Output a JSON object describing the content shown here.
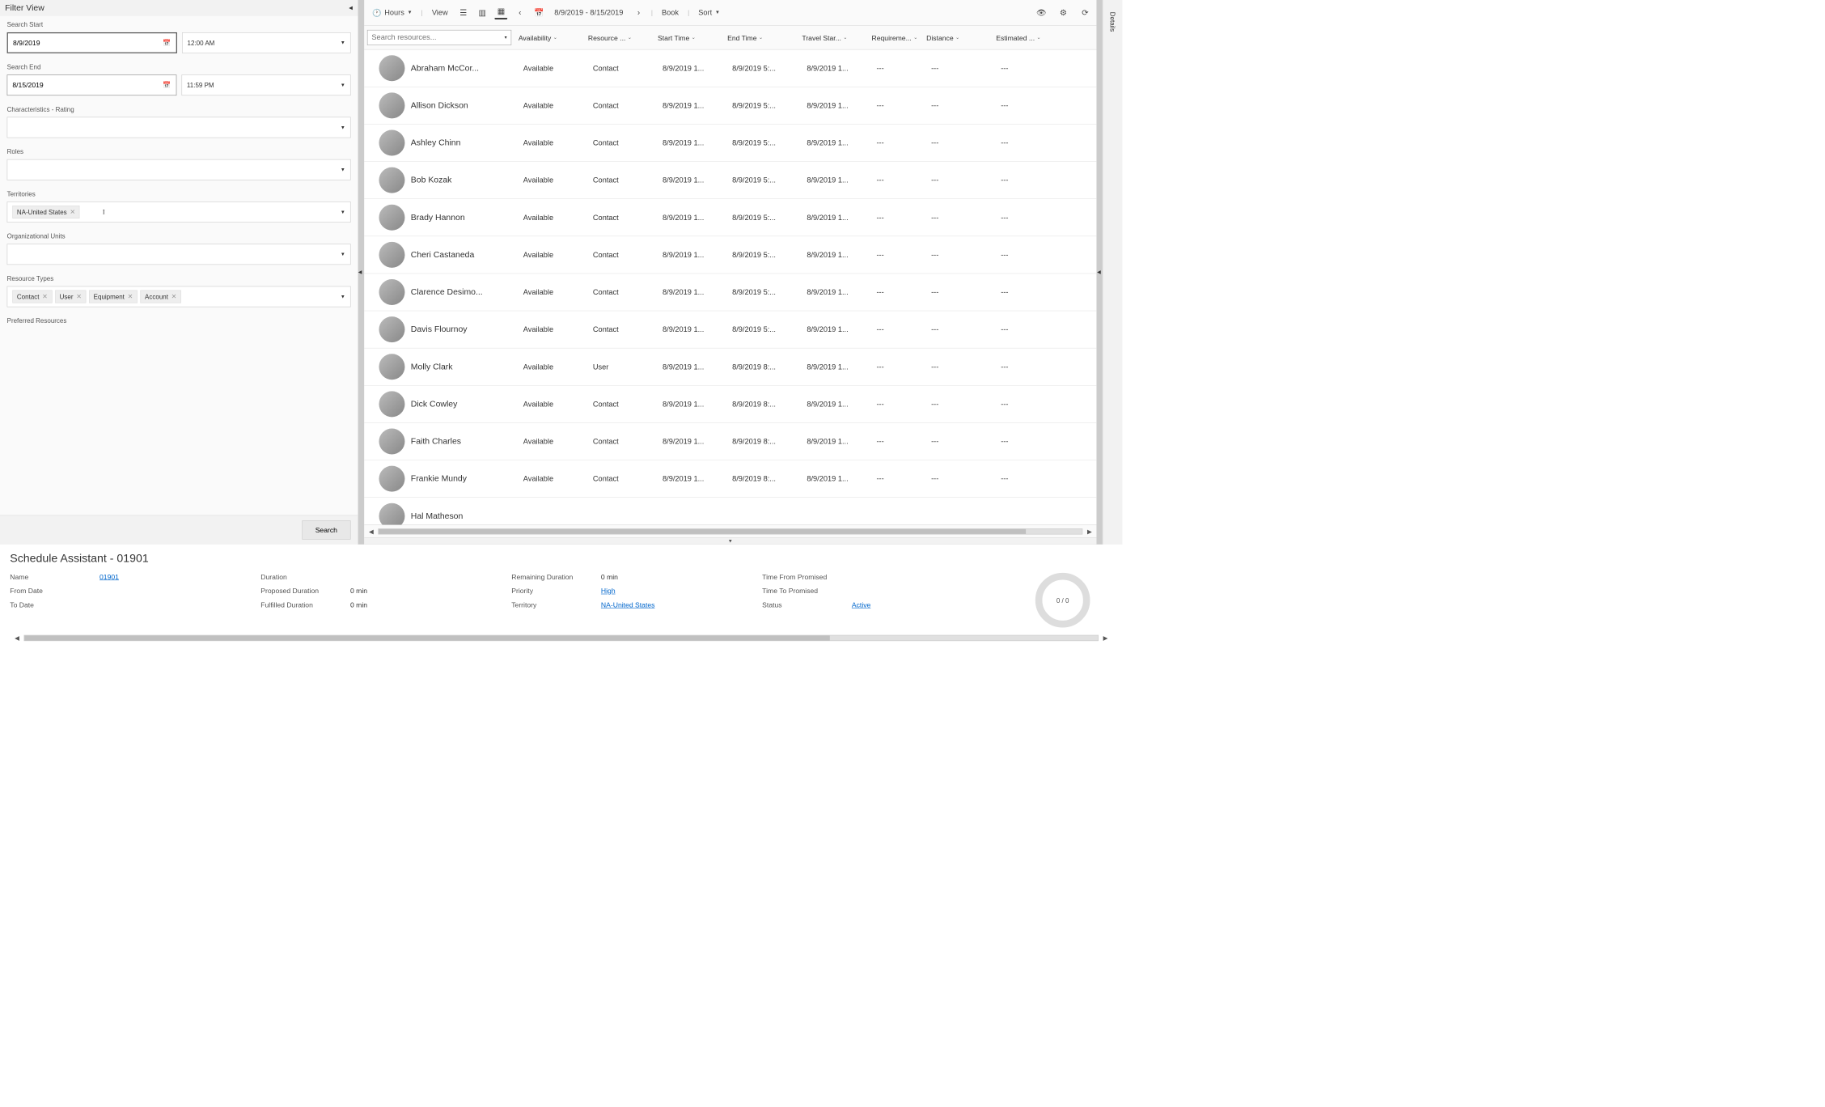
{
  "filter": {
    "title": "Filter View",
    "search_start_label": "Search Start",
    "search_start_date": "8/9/2019",
    "search_start_time": "12:00 AM",
    "search_end_label": "Search End",
    "search_end_date": "8/15/2019",
    "search_end_time": "11:59 PM",
    "characteristics_label": "Characteristics - Rating",
    "roles_label": "Roles",
    "territories_label": "Territories",
    "territories_tags": [
      "NA-United States"
    ],
    "org_units_label": "Organizational Units",
    "resource_types_label": "Resource Types",
    "resource_types_tags": [
      "Contact",
      "User",
      "Equipment",
      "Account"
    ],
    "preferred_label": "Preferred Resources",
    "search_btn": "Search"
  },
  "toolbar": {
    "hours_label": "Hours",
    "view_label": "View",
    "date_range": "8/9/2019 - 8/15/2019",
    "book_label": "Book",
    "sort_label": "Sort"
  },
  "grid": {
    "search_placeholder": "Search resources...",
    "columns": [
      "Availability",
      "Resource ...",
      "Start Time",
      "End Time",
      "Travel Star...",
      "Requireme...",
      "Distance",
      "Estimated ..."
    ],
    "rows": [
      {
        "name": "Abraham McCor...",
        "avail": "Available",
        "type": "Contact",
        "start": "8/9/2019 1...",
        "end": "8/9/2019 5:...",
        "travel": "8/9/2019 1...",
        "req": "---",
        "dist": "---",
        "est": "---"
      },
      {
        "name": "Allison Dickson",
        "avail": "Available",
        "type": "Contact",
        "start": "8/9/2019 1...",
        "end": "8/9/2019 5:...",
        "travel": "8/9/2019 1...",
        "req": "---",
        "dist": "---",
        "est": "---"
      },
      {
        "name": "Ashley Chinn",
        "avail": "Available",
        "type": "Contact",
        "start": "8/9/2019 1...",
        "end": "8/9/2019 5:...",
        "travel": "8/9/2019 1...",
        "req": "---",
        "dist": "---",
        "est": "---"
      },
      {
        "name": "Bob Kozak",
        "avail": "Available",
        "type": "Contact",
        "start": "8/9/2019 1...",
        "end": "8/9/2019 5:...",
        "travel": "8/9/2019 1...",
        "req": "---",
        "dist": "---",
        "est": "---"
      },
      {
        "name": "Brady Hannon",
        "avail": "Available",
        "type": "Contact",
        "start": "8/9/2019 1...",
        "end": "8/9/2019 5:...",
        "travel": "8/9/2019 1...",
        "req": "---",
        "dist": "---",
        "est": "---"
      },
      {
        "name": "Cheri Castaneda",
        "avail": "Available",
        "type": "Contact",
        "start": "8/9/2019 1...",
        "end": "8/9/2019 5:...",
        "travel": "8/9/2019 1...",
        "req": "---",
        "dist": "---",
        "est": "---"
      },
      {
        "name": "Clarence Desimo...",
        "avail": "Available",
        "type": "Contact",
        "start": "8/9/2019 1...",
        "end": "8/9/2019 5:...",
        "travel": "8/9/2019 1...",
        "req": "---",
        "dist": "---",
        "est": "---"
      },
      {
        "name": "Davis Flournoy",
        "avail": "Available",
        "type": "Contact",
        "start": "8/9/2019 1...",
        "end": "8/9/2019 5:...",
        "travel": "8/9/2019 1...",
        "req": "---",
        "dist": "---",
        "est": "---"
      },
      {
        "name": "Molly Clark",
        "avail": "Available",
        "type": "User",
        "start": "8/9/2019 1...",
        "end": "8/9/2019 8:...",
        "travel": "8/9/2019 1...",
        "req": "---",
        "dist": "---",
        "est": "---"
      },
      {
        "name": "Dick Cowley",
        "avail": "Available",
        "type": "Contact",
        "start": "8/9/2019 1...",
        "end": "8/9/2019 8:...",
        "travel": "8/9/2019 1...",
        "req": "---",
        "dist": "---",
        "est": "---"
      },
      {
        "name": "Faith Charles",
        "avail": "Available",
        "type": "Contact",
        "start": "8/9/2019 1...",
        "end": "8/9/2019 8:...",
        "travel": "8/9/2019 1...",
        "req": "---",
        "dist": "---",
        "est": "---"
      },
      {
        "name": "Frankie Mundy",
        "avail": "Available",
        "type": "Contact",
        "start": "8/9/2019 1...",
        "end": "8/9/2019 8:...",
        "travel": "8/9/2019 1...",
        "req": "---",
        "dist": "---",
        "est": "---"
      },
      {
        "name": "Hal Matheson",
        "avail": "",
        "type": "",
        "start": "",
        "end": "",
        "travel": "",
        "req": "",
        "dist": "",
        "est": ""
      }
    ]
  },
  "details_rail": "Details",
  "footer": {
    "heading": "Schedule Assistant - 01901",
    "col1": [
      {
        "label": "Name",
        "value": "01901",
        "link": true
      },
      {
        "label": "From Date",
        "value": ""
      },
      {
        "label": "To Date",
        "value": ""
      }
    ],
    "col2": [
      {
        "label": "Duration",
        "value": ""
      },
      {
        "label": "Proposed Duration",
        "value": "0 min"
      },
      {
        "label": "Fulfilled Duration",
        "value": "0 min"
      }
    ],
    "col3": [
      {
        "label": "Remaining Duration",
        "value": "0 min"
      },
      {
        "label": "Priority",
        "value": "High",
        "link": true
      },
      {
        "label": "Territory",
        "value": "NA-United States",
        "link": true
      }
    ],
    "col4": [
      {
        "label": "Time From Promised",
        "value": ""
      },
      {
        "label": "Time To Promised",
        "value": ""
      },
      {
        "label": "Status",
        "value": "Active",
        "link": true
      }
    ],
    "donut_text": "0 / 0"
  }
}
